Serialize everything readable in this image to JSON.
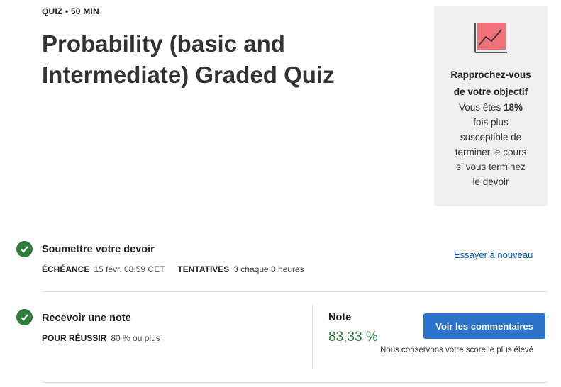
{
  "header": {
    "meta": "QUIZ • 50 MIN",
    "title": "Probability (basic and Intermediate) Graded Quiz"
  },
  "side_card": {
    "icon": "chart-icon",
    "heading_line1": "Rapprochez-vous",
    "heading_line2": "de votre objectif",
    "body_prefix": "Vous êtes ",
    "body_percent": "18%",
    "body_lines": [
      "fois plus",
      "susceptible de",
      "terminer le cours",
      "si vous terminez",
      "le devoir"
    ],
    "accent_color": "#f0717a"
  },
  "submit": {
    "title": "Soumettre votre devoir",
    "deadline_label": "ÉCHÉANCE",
    "deadline_value": "15 févr. 08:59 CET",
    "attempts_label": "TENTATIVES",
    "attempts_value": "3 chaque 8 heures",
    "retry_link": "Essayer à nouveau"
  },
  "grade": {
    "title": "Recevoir une note",
    "pass_label": "POUR RÉUSSIR",
    "pass_value": "80 % ou plus",
    "note_label": "Note",
    "note_value": "83,33 %",
    "feedback_button": "Voir les commentaires",
    "keep_score_note": "Nous conservons votre score le plus élevé"
  },
  "colors": {
    "success": "#2e7d3c",
    "primary": "#2a73cc",
    "link": "#0056d2"
  }
}
